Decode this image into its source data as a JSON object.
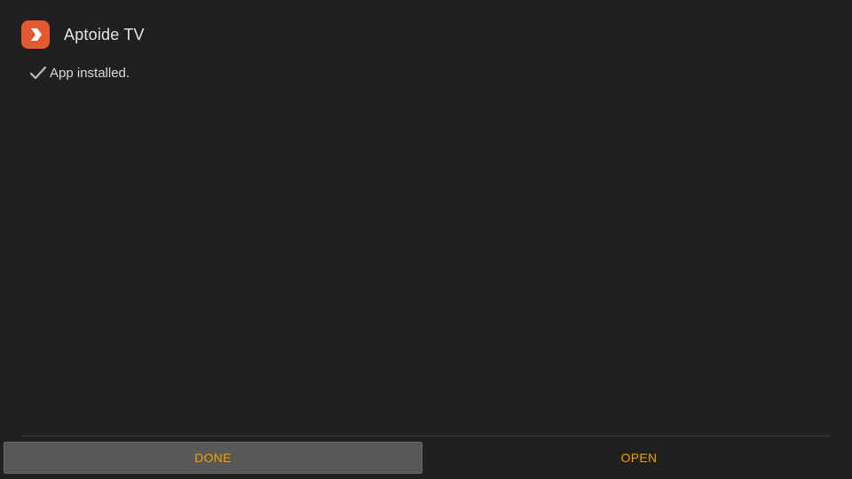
{
  "header": {
    "app_icon": "aptoide-logo-icon",
    "app_title": "Aptoide TV"
  },
  "status": {
    "icon": "check-icon",
    "text": "App installed."
  },
  "actions": {
    "done_label": "DONE",
    "open_label": "OPEN"
  },
  "colors": {
    "background": "#202020",
    "accent": "#f0a000",
    "icon_bg": "#e25a2f",
    "focused_button_bg": "#585858"
  }
}
